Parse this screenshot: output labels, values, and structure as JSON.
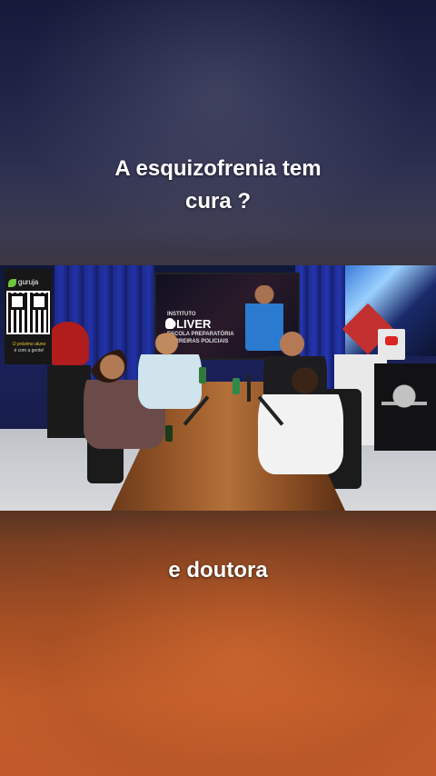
{
  "captions": {
    "top_line1": "A esquizofrenia tem",
    "top_line2": "cura ?",
    "bottom": "e doutora"
  },
  "video": {
    "qr_panel": {
      "brand": "guruja",
      "line1": "O próximo aluno",
      "line2": "é com a gente!"
    },
    "screen": {
      "brand_top": "INSTITUTO",
      "brand_name": "OLIVER",
      "brand_sub1": "ESCOLA PREPARATÓRIA",
      "brand_sub2": "CARREIRAS POLICIAIS"
    }
  },
  "colors": {
    "caption_text": "#ffffff",
    "top_background": "#1f2346",
    "bottom_background": "#c05a2a"
  }
}
